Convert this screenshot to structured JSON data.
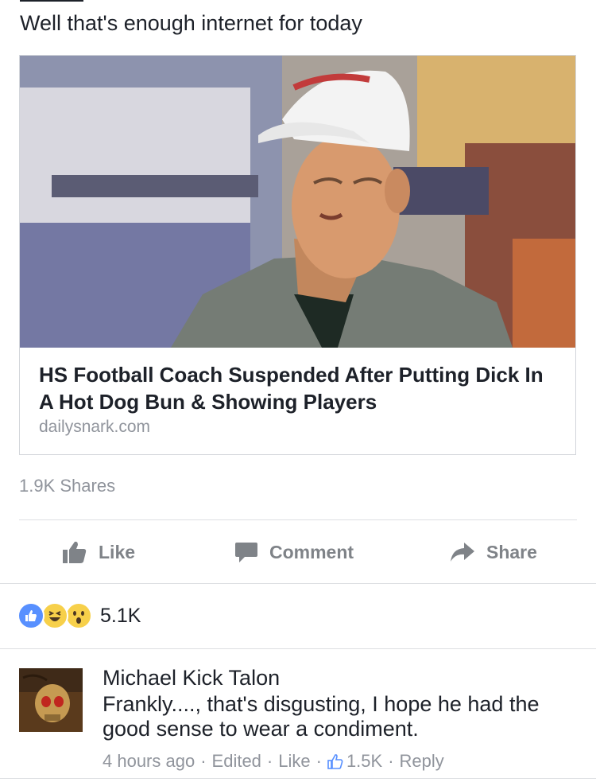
{
  "post": {
    "text": "Well that's enough internet for today"
  },
  "link_card": {
    "title": "HS Football Coach Suspended After Putting Dick In A Hot Dog Bun & Showing Players",
    "domain": "dailysnark.com",
    "image_icon": "coach-photo"
  },
  "shares": "1.9K Shares",
  "actions": {
    "like": "Like",
    "comment": "Comment",
    "share": "Share"
  },
  "reactions": {
    "icons": [
      "like-reaction-icon",
      "haha-reaction-icon",
      "wow-reaction-icon"
    ],
    "count": "5.1K"
  },
  "comment": {
    "author": "Michael Kick Talon",
    "text": "Frankly...., that's disgusting, I hope he had the good sense to wear a condiment.",
    "time": "4 hours ago",
    "edited": "Edited",
    "like": "Like",
    "like_count": "1.5K",
    "reply": "Reply",
    "separator": "·"
  },
  "colors": {
    "text": "#1d2129",
    "secondary": "#90949c",
    "action": "#7f8388",
    "like_blue": "#5890ff",
    "emoji_yellow": "#f7d04a"
  }
}
